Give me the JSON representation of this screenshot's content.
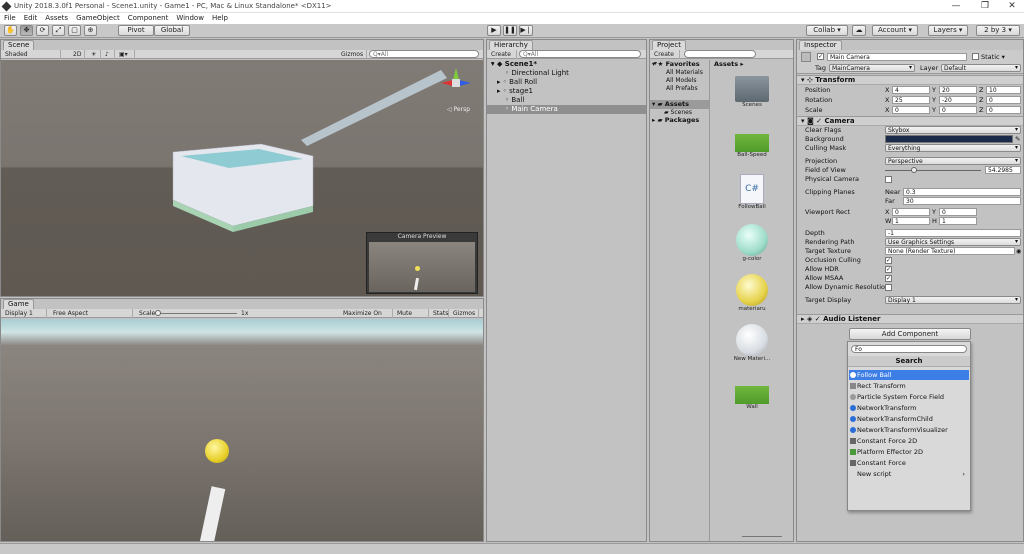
{
  "window": {
    "title": "Unity 2018.3.0f1 Personal - Scene1.unity - Game1 - PC, Mac & Linux Standalone* <DX11>",
    "controls": [
      "—",
      "❐",
      "✕"
    ]
  },
  "menu": [
    "File",
    "Edit",
    "Assets",
    "GameObject",
    "Component",
    "Window",
    "Help"
  ],
  "toolbar": {
    "tools": [
      "✋",
      "✥",
      "⟳",
      "⤢",
      "▢",
      "⊕"
    ],
    "pivot": "Pivot",
    "global": "Global",
    "collab": "Collab ▾",
    "cloud": "☁",
    "account": "Account ▾",
    "layers": "Layers ▾",
    "layout": "2 by 3 ▾"
  },
  "scene": {
    "tab": "Scene",
    "shading": "Shaded",
    "mode2d": "2D",
    "gizmos": "Gizmos ▾",
    "search": "Q▾All",
    "persp": "◁ Persp",
    "camera_preview": "Camera Preview"
  },
  "game": {
    "tab": "Game",
    "display": "Display 1",
    "aspect": "Free Aspect",
    "scale_label": "Scale",
    "scale_value": "1x",
    "maximize": "Maximize On Play",
    "mute": "Mute Audio",
    "stats": "Stats",
    "gizmos": "Gizmos ▾"
  },
  "hierarchy": {
    "tab": "Hierarchy",
    "create": "Create ▾",
    "search": "Q▾All",
    "scene": "Scene1*",
    "items": [
      "Directional Light",
      "Ball Roll",
      "stage1",
      "Ball",
      "Main Camera"
    ]
  },
  "project": {
    "tab": "Project",
    "create": "Create ▾",
    "favorites": "Favorites",
    "fav_items": [
      "All Materials",
      "All Models",
      "All Prefabs"
    ],
    "assets_root": "Assets",
    "assets_sub": [
      "Scenes"
    ],
    "packages": "Packages",
    "breadcrumb": "Assets ▸",
    "assets": [
      "Scenes",
      "Ball-Speed",
      "FollowBall",
      "g-color",
      "materiaru",
      "New Materi...",
      "Wall"
    ],
    "script_icon": "C#"
  },
  "inspector": {
    "tab": "Inspector",
    "name": "Main Camera",
    "static": "Static ▾",
    "tag_label": "Tag",
    "tag": "MainCamera",
    "layer_label": "Layer",
    "layer": "Default",
    "transform": {
      "title": "Transform",
      "rows": [
        {
          "label": "Position",
          "x": "4",
          "y": "20",
          "z": "10"
        },
        {
          "label": "Rotation",
          "x": "25",
          "y": "-20",
          "z": "0"
        },
        {
          "label": "Scale",
          "x": "0",
          "y": "0",
          "z": "0"
        }
      ]
    },
    "camera": {
      "title": "Camera",
      "clear_flags_label": "Clear Flags",
      "clear_flags": "Skybox",
      "background_label": "Background",
      "background_color": "#1c2a4a",
      "culling_label": "Culling Mask",
      "culling": "Everything",
      "projection_label": "Projection",
      "projection": "Perspective",
      "fov_label": "Field of View",
      "fov": "54.2985",
      "fov_fraction": 0.3,
      "physical_label": "Physical Camera",
      "clipping_label": "Clipping Planes",
      "near_label": "Near",
      "near": "0.3",
      "far_label": "Far",
      "far": "30",
      "viewport_label": "Viewport Rect",
      "vx": "0",
      "vy": "0",
      "vw": "1",
      "vh": "1",
      "depth_label": "Depth",
      "depth": "-1",
      "rendering_label": "Rendering Path",
      "rendering": "Use Graphics Settings",
      "target_tex_label": "Target Texture",
      "target_tex": "None (Render Texture)",
      "occlusion_label": "Occlusion Culling",
      "hdr_label": "Allow HDR",
      "msaa_label": "Allow MSAA",
      "dynres_label": "Allow Dynamic Resolution",
      "target_display_label": "Target Display",
      "target_display": "Display 1"
    },
    "audio": {
      "title": "Audio Listener"
    },
    "add_component": "Add Component"
  },
  "popup": {
    "search_value": "Fo",
    "header": "Search",
    "items": [
      "Follow Ball",
      "Rect Transform",
      "Particle System Force Field",
      "NetworkTransform",
      "NetworkTransformChild",
      "NetworkTransformVisualizer",
      "Constant Force 2D",
      "Platform Effector 2D",
      "Constant Force",
      "New script"
    ],
    "selected_index": 0
  },
  "colors": {
    "accent": "#3c7ee6",
    "scene_sky": "#7a7470",
    "scene_ground": "#615b55"
  }
}
